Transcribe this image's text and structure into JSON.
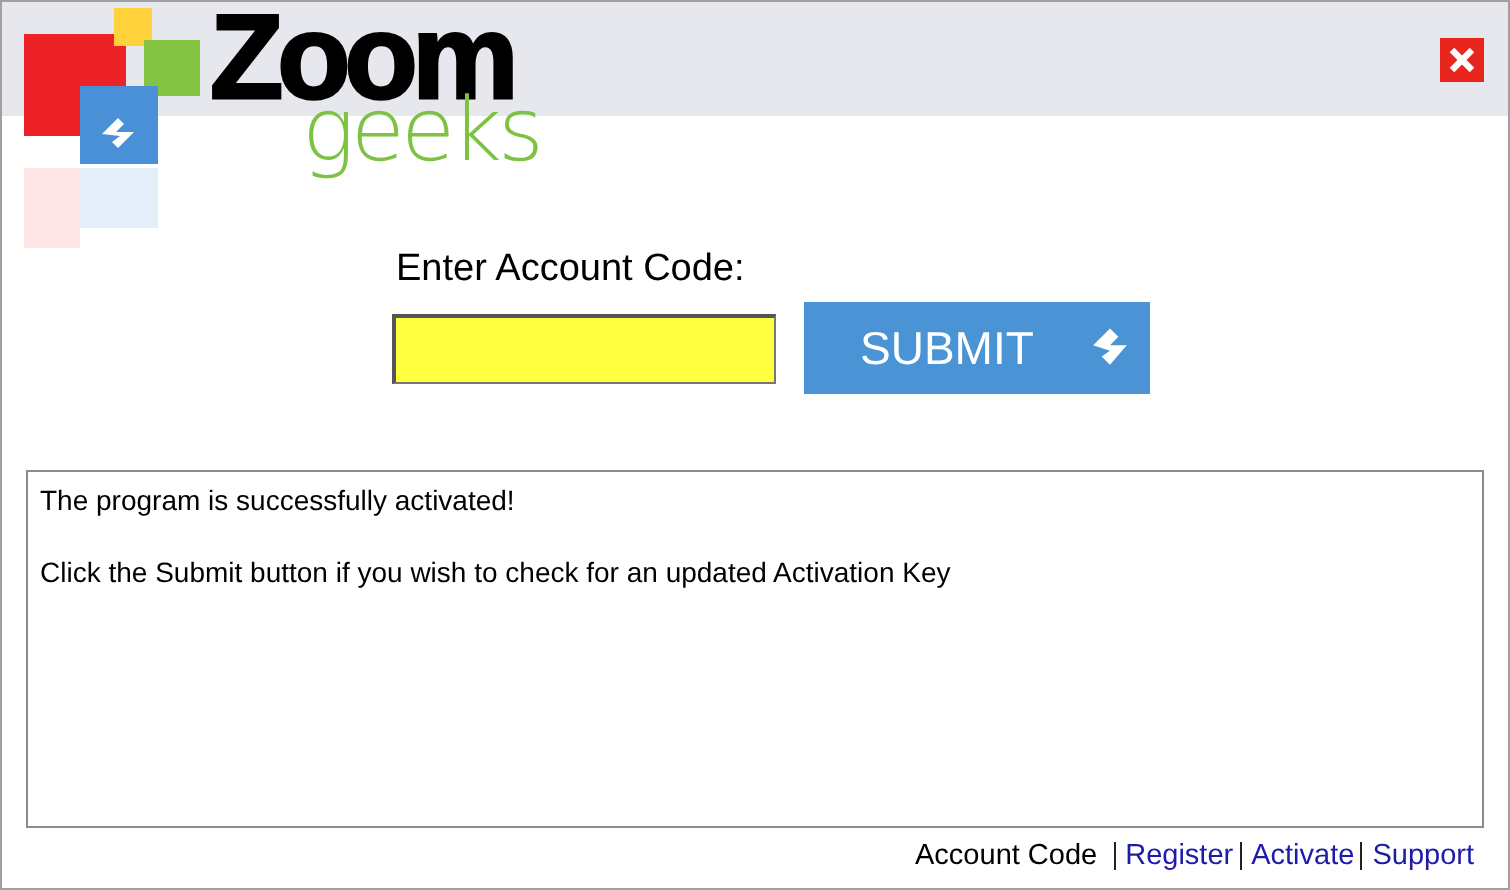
{
  "logo": {
    "word_1": "Zoom",
    "word_2": "geeks"
  },
  "form": {
    "label": "Enter Account Code:",
    "submit": "SUBMIT"
  },
  "message": [
    "The program is successfully activated!",
    "Click the Submit button if you wish to check for an updated Activation Key"
  ],
  "footer_links": [
    {
      "label": "Account Code",
      "kind": "text"
    },
    {
      "label": "Register",
      "kind": "link"
    },
    {
      "label": "Activate",
      "kind": "link"
    },
    {
      "label": "Support",
      "kind": "link"
    }
  ]
}
